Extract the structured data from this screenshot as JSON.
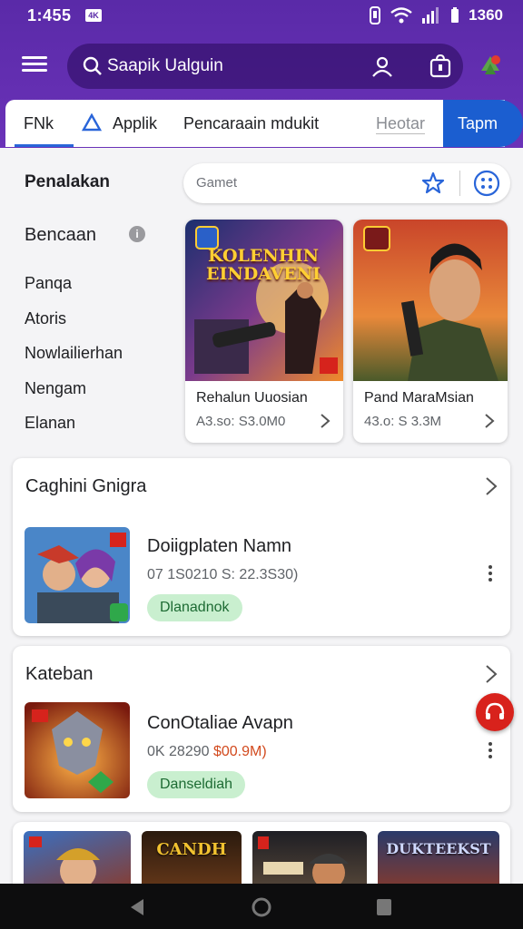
{
  "status": {
    "time": "1:455",
    "badge": "4K",
    "battery": "1360"
  },
  "search": {
    "text": "Saapik Ualguin"
  },
  "tabs": {
    "t1": "FNk",
    "t2": "Applik",
    "t3": "Pencaraain mdukit",
    "t4": "Heotar",
    "action": "Tapm"
  },
  "sidebar": {
    "heading": "Penalakan",
    "subheading": "Bencaan",
    "items": [
      "Panqa",
      "Atoris",
      "Nowlailierhan",
      "Nengam",
      "Elanan"
    ]
  },
  "filter": {
    "placeholder": "Gamet"
  },
  "featured": [
    {
      "art_title": "KOLENHIN EINDAVENI",
      "title": "Rehalun Uuosian",
      "meta": "A3.so: S3.0M0"
    },
    {
      "title": "Pand MaraMsian",
      "meta": "43.o: S 3.3M"
    }
  ],
  "sections": [
    {
      "title": "Caghini Gnigra",
      "app_name": "Doiigplaten Namn",
      "meta": "07 1S0210 S: 22.3S30)",
      "meta_highlight": "",
      "pill": "Dlanadnok"
    },
    {
      "title": "Kateban",
      "app_name": "ConOtaliae Avapn",
      "meta": "0K 28290 ",
      "meta_highlight": "$00.9M)",
      "pill": "Danseldiah"
    }
  ],
  "strip": {
    "t2": "CANDH",
    "t4": "DUKTEEKST"
  },
  "colors": {
    "appbar": "#5a2aa8",
    "accent": "#2965d9",
    "action": "#1b5ed0",
    "pill_bg": "#c9efcf",
    "fab": "#d8221c"
  }
}
